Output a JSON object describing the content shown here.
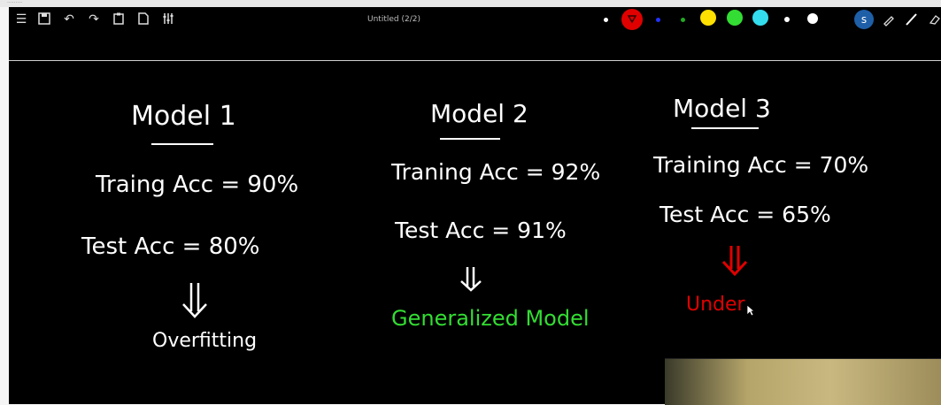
{
  "window": {
    "title": "Untitled (2/2)"
  },
  "toolbar": {
    "left_icons": [
      "menu-icon",
      "save-icon",
      "undo-icon",
      "redo-icon",
      "clipboard-icon",
      "page-icon",
      "sliders-icon"
    ],
    "right_icons": [
      "avatar-icon",
      "highlighter-icon",
      "pen-icon",
      "eraser-icon"
    ]
  },
  "palette": {
    "colors": [
      "#ffffff",
      "#e00000",
      "#2233ff",
      "#22aa22",
      "#ffe000",
      "#33dd33",
      "#33ddee",
      "#ffffff",
      "#ffffff"
    ],
    "selected": "#e00000"
  },
  "board": {
    "model1": {
      "title": "Model 1",
      "train": "Traing Acc = 90%",
      "test": "Test   Acc = 80%",
      "result": "Overfitting"
    },
    "model2": {
      "title": "Model 2",
      "train": "Traning Acc = 92%",
      "test": "Test  Acc = 91%",
      "result": "Generalized Model"
    },
    "model3": {
      "title": "Model 3",
      "train": "Training Acc = 70%",
      "test": "Test  Acc = 65%",
      "result": "Under"
    }
  }
}
